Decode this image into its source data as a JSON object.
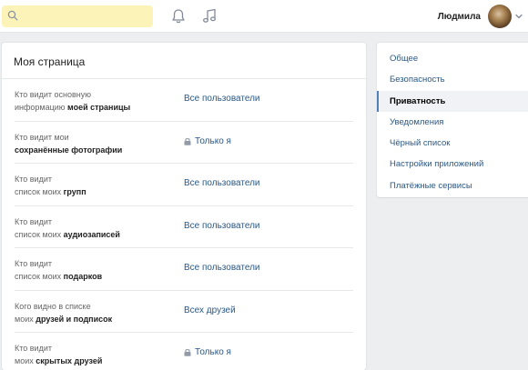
{
  "search": {
    "placeholder": "",
    "icon": "search-icon"
  },
  "header": {
    "bell_icon": "bell-icon",
    "music_icon": "music-note-icon",
    "user_name": "Людмила",
    "chevron_icon": "chevron-down-icon"
  },
  "main": {
    "title": "Моя страница",
    "rows": [
      {
        "line1": "Кто видит основную",
        "pre": "информацию ",
        "bold": "моей страницы",
        "value": "Все пользователи",
        "locked": false
      },
      {
        "line1": "Кто видит мои",
        "pre": "",
        "bold": "сохранённые фотографии",
        "value": "Только я",
        "locked": true
      },
      {
        "line1": "Кто видит",
        "pre": "список моих ",
        "bold": "групп",
        "value": "Все пользователи",
        "locked": false
      },
      {
        "line1": "Кто видит",
        "pre": "список моих ",
        "bold": "аудиозаписей",
        "value": "Все пользователи",
        "locked": false
      },
      {
        "line1": "Кто видит",
        "pre": "список моих ",
        "bold": "подарков",
        "value": "Все пользователи",
        "locked": false
      },
      {
        "line1": "Кого видно в списке",
        "pre": "моих ",
        "bold": "друзей и подписок",
        "value": "Всех друзей",
        "locked": false
      },
      {
        "line1": "Кто видит",
        "pre": "моих ",
        "bold": "скрытых друзей",
        "value": "Только я",
        "locked": true
      }
    ]
  },
  "sidebar": {
    "items": [
      {
        "label": "Общее",
        "active": false
      },
      {
        "label": "Безопасность",
        "active": false
      },
      {
        "label": "Приватность",
        "active": true
      },
      {
        "label": "Уведомления",
        "active": false
      },
      {
        "label": "Чёрный список",
        "active": false
      },
      {
        "label": "Настройки приложений",
        "active": false
      },
      {
        "label": "Платёжные сервисы",
        "active": false
      }
    ]
  },
  "colors": {
    "accent": "#5181b8",
    "link": "#2a5885",
    "search_bg": "#fbf3b8",
    "page_bg": "#edeef0"
  }
}
